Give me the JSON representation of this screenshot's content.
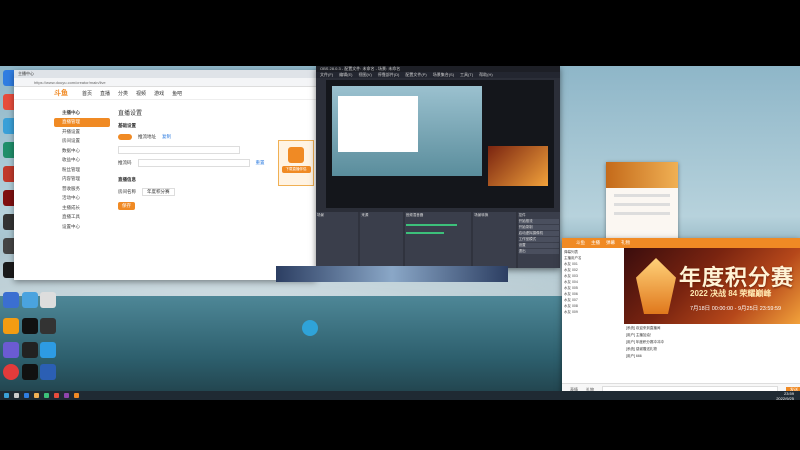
{
  "browser": {
    "tab_title": "主播中心",
    "address": "https://www.douyu.com/creator/main/live",
    "site_logo": "斗鱼",
    "nav": [
      "首页",
      "直播",
      "分类",
      "视频",
      "游戏",
      "鱼吧"
    ],
    "sidebar": [
      "主播中心",
      "直播管理",
      "开播设置",
      "房间设置",
      "数据中心",
      "收益中心",
      "粉丝管理",
      "内容管理",
      "营收服务",
      "活动中心",
      "主播成长",
      "直播工具",
      "设置中心"
    ],
    "section_title": "直播设置",
    "basic_label": "基础设置",
    "rtmp_label": "推流地址",
    "key_label": "推流码",
    "copy_label": "复制",
    "reset_label": "重置",
    "live_info_label": "直播信息",
    "room_label": "房间名称",
    "room_value": "年度积分赛",
    "save_button": "保存",
    "promo_button": "下载直播伴侣"
  },
  "obs": {
    "title": "OBS 28.0.3 - 配置文件: 未命名 - 场景: 未命名",
    "menu": [
      "文件(F)",
      "编辑(E)",
      "视图(V)",
      "停靠部件(D)",
      "配置文件(P)",
      "场景集合(S)",
      "工具(T)",
      "帮助(H)"
    ],
    "docks": [
      "场景",
      "来源",
      "音频混音器",
      "场景转换",
      "控件"
    ],
    "controls": [
      "开始推流",
      "开始录制",
      "启动虚拟摄像机",
      "工作室模式",
      "设置",
      "退出"
    ]
  },
  "chat": {
    "header_items": [
      "斗鱼",
      "主播",
      "弹幕",
      "礼物"
    ],
    "banner_title": "年度积分赛",
    "banner_sub": "2022 决战 84 荣耀巅峰",
    "banner_date": "7月18日 00:00:00 - 9月25日 23:59:59",
    "list": [
      "弹幕列表",
      "主播用户名",
      "水友 001",
      "水友 002",
      "水友 003",
      "水友 004",
      "水友 005",
      "水友 006",
      "水友 007",
      "水友 008",
      "水友 009"
    ],
    "messages": [
      "[系统] 欢迎来到直播间",
      "[用户] 主播加油！",
      "[用户] 年度积分赛冲冲冲",
      "[系统] 感谢赠送礼物",
      "[用户] 666"
    ],
    "footer": [
      "表情",
      "礼物",
      "发送"
    ]
  },
  "taskbar": {
    "time": "23:59",
    "date": "2022/9/25"
  }
}
